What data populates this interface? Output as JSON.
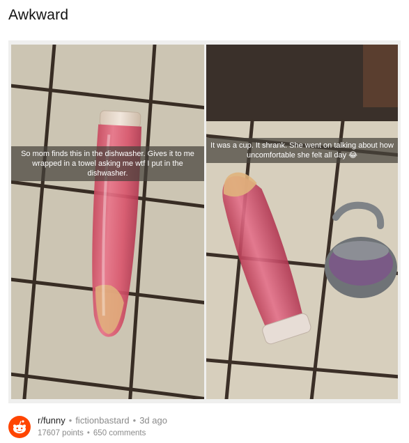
{
  "post": {
    "title": "Awkward",
    "captions": {
      "left": "So mom finds this in the dishwasher. Gives it to me wrapped in a towel asking me wtf I put in the dishwasher.",
      "right": "It was a cup. It shrank. She went on talking about how uncomfortable she felt all day 😂"
    }
  },
  "meta": {
    "subreddit": "r/funny",
    "author": "fictionbastard",
    "age": "3d ago",
    "points": "17607 points",
    "comments": "650 comments",
    "separator": "•"
  },
  "icons": {
    "logo": "reddit-alien-icon"
  },
  "colors": {
    "reddit_orange": "#ff4500",
    "muted_text": "#8a8a8a",
    "caption_bg": "#46423c"
  }
}
